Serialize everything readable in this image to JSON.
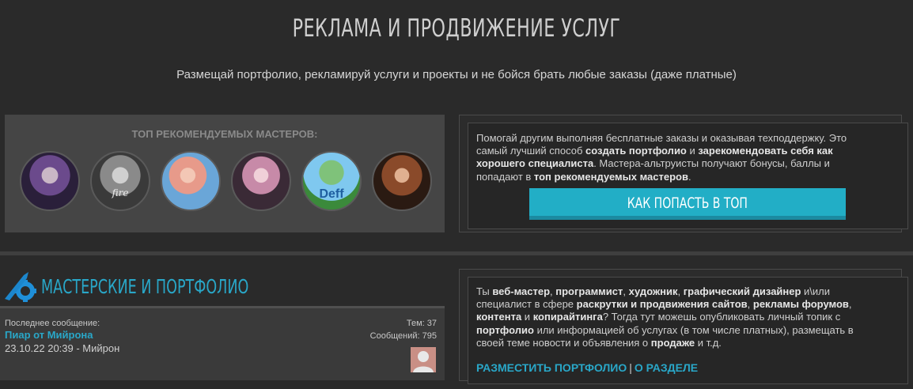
{
  "header": {
    "title": "РЕКЛАМА И ПРОДВИЖЕНИЕ УСЛУГ",
    "subtitle": "Размещай портфолио, рекламируй услуги и проекты и не бойся брать любые заказы (даже платные)"
  },
  "masters": {
    "title": "ТОП РЕКОМЕНДУЕМЫХ МАСТЕРОВ:",
    "avatars": [
      {
        "label": "",
        "colors": [
          "#6b4a8c",
          "#2a1f3a"
        ]
      },
      {
        "label": "fire",
        "colors": [
          "#9a9a9a",
          "#3a3a3a"
        ]
      },
      {
        "label": "",
        "colors": [
          "#e79a8a",
          "#6aa6d8"
        ]
      },
      {
        "label": "",
        "colors": [
          "#c78aa8",
          "#3a2a36"
        ]
      },
      {
        "label": "Deff",
        "colors": [
          "#7fc8ef",
          "#3b8a3b"
        ]
      },
      {
        "label": "",
        "colors": [
          "#8a4a2a",
          "#2a1a12"
        ]
      }
    ]
  },
  "help_box": {
    "p1": "Помогай другим выполняя бесплатные заказы и оказывая техподдержку. Это",
    "p2a": "самый лучший способ ",
    "p2b": "создать портфолио",
    "p2c": " и ",
    "p2d": "зарекомендовать себя как",
    "p3a": "хорошего специалиста",
    "p3b": ". Мастера-альтруисты получают бонусы, баллы и",
    "p4a": "попадают в ",
    "p4b": "топ рекомендуемых мастеров",
    "p4c": ".",
    "cta": "КАК ПОПАСТЬ В ТОП"
  },
  "forum": {
    "title": "МАСТЕРСКИЕ И ПОРТФОЛИО",
    "last_label": "Последнее сообщение:",
    "last_topic": "Пиар от Мийрона",
    "last_date": "23.10.22 20:39 - Мийрон",
    "topics": "Тем: 37",
    "posts": "Сообщений: 795"
  },
  "about_box": {
    "l1a": "Ты ",
    "l1b": "веб-мастер",
    "l1c": ", ",
    "l1d": "программист",
    "l1e": ", ",
    "l1f": "художник",
    "l1g": ", ",
    "l1h": "графический дизайнер",
    "l1i": " и\\или",
    "l2a": "специалист в сфере ",
    "l2b": "раскрутки и продвижения сайтов",
    "l2c": ", ",
    "l2d": "рекламы форумов",
    "l2e": ",",
    "l3a": "контента",
    "l3b": " и ",
    "l3c": "копирайтинга",
    "l3d": "? Тогда тут можешь опубликовать личный топик с",
    "l4a": "портфолио",
    "l4b": " или информацией об услугах (в том числе платных), размещать в",
    "l5a": "своей теме новости и объявления о ",
    "l5b": "продаже",
    "l5c": " и т.д.",
    "link1": "РАЗМЕСТИТЬ ПОРТФОЛИО",
    "sep": "|",
    "link2": "О РАЗДЕЛЕ"
  },
  "colors": {
    "accent": "#29a7c8",
    "cta": "#22aec6",
    "bg": "#2a2a2a"
  }
}
